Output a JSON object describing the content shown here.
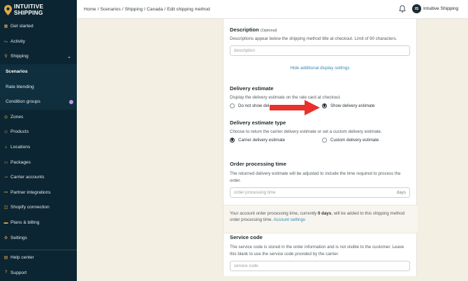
{
  "brand": {
    "line1": "INTUITIVE",
    "line2": "SHIPPING",
    "accent": "#e0a84b"
  },
  "sidebar": {
    "items": [
      {
        "label": "Get started",
        "icon": "grid-icon"
      },
      {
        "label": "Activity",
        "icon": "activity-icon"
      },
      {
        "label": "Shipping",
        "icon": "shipping-icon"
      },
      {
        "label": "Scenarios"
      },
      {
        "label": "Rate blending"
      },
      {
        "label": "Condition groups"
      },
      {
        "label": "Zones",
        "icon": "globe-icon"
      },
      {
        "label": "Products",
        "icon": "tag-icon"
      },
      {
        "label": "Locations",
        "icon": "location-icon"
      },
      {
        "label": "Packages",
        "icon": "package-icon"
      },
      {
        "label": "Carrier accounts",
        "icon": "truck-icon"
      },
      {
        "label": "Partner integrations",
        "icon": "plug-icon"
      },
      {
        "label": "Shopify connection",
        "icon": "shopify-icon"
      },
      {
        "label": "Plans & billing",
        "icon": "card-icon"
      },
      {
        "label": "Settings",
        "icon": "gear-icon"
      }
    ],
    "bottom": [
      {
        "label": "Help center",
        "icon": "book-icon"
      },
      {
        "label": "Support",
        "icon": "help-icon"
      }
    ]
  },
  "topbar": {
    "breadcrumb": [
      "Home",
      "/",
      "Scenarios",
      "/",
      "Shipping",
      "/",
      "Canada",
      "/",
      "Edit shipping method"
    ],
    "avatar_initials": "IS",
    "account_name": "Intuitive Shipping"
  },
  "form": {
    "description": {
      "title": "Description",
      "optional": "(Optional)",
      "help": "Descriptions appear below the shipping method title at checkout. Limit of 90 characters.",
      "placeholder": "description",
      "hide_link": "Hide additional display settings"
    },
    "delivery_estimate": {
      "title": "Delivery estimate",
      "help": "Display the delivery estimate on the rate card at checkout.",
      "option_no": "Do not show del",
      "option_yes": "Show delivery estimate"
    },
    "estimate_type": {
      "title": "Delivery estimate type",
      "help": "Choose to return the carrier delivery estimate or set a custom delivery estimate.",
      "option_carrier": "Carrier delivery estimate",
      "option_custom": "Custom delivery estimate"
    },
    "processing": {
      "title": "Order processing time",
      "help": "The returned delivery estimate will be adjusted to include the time required to process the order.",
      "placeholder": "order processing time",
      "unit": "days"
    },
    "notice": {
      "before": "Your account order processing time, currently ",
      "value": "0 days",
      "after": ", will be added to this shipping method order processing time. ",
      "link": "Account settings"
    },
    "service_code": {
      "title": "Service code",
      "help": "The service code is stored in the order information and is not visible to the customer. Leave this blank to use the service code provided by the carrier.",
      "placeholder": "service code"
    }
  },
  "colors": {
    "sidebar_bg": "#0b2532",
    "page_bg": "#f3efe3",
    "link": "#3a87b4",
    "annotation_arrow": "#e8312a"
  }
}
